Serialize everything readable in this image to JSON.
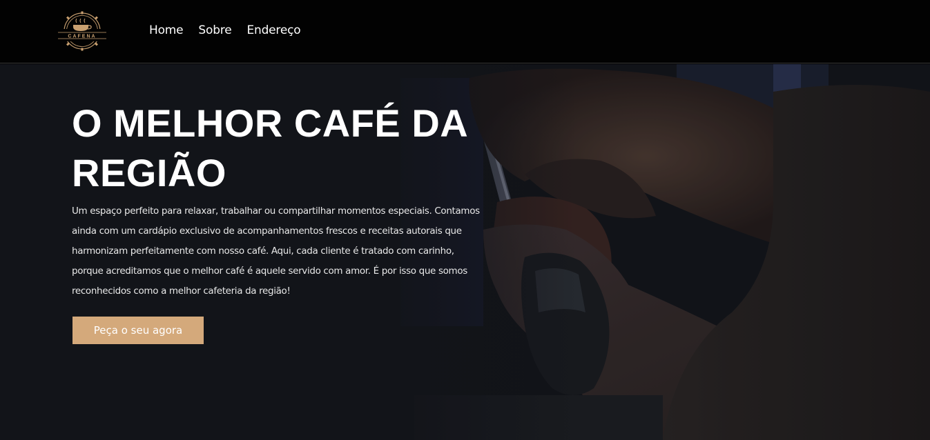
{
  "brand": {
    "logo_text": "CAFENA"
  },
  "nav": {
    "items": [
      {
        "label": "Home"
      },
      {
        "label": "Sobre"
      },
      {
        "label": "Endereço"
      }
    ]
  },
  "hero": {
    "title": "O MELHOR CAFÉ DA REGIÃO",
    "text": "Um espaço perfeito para relaxar, trabalhar ou compartilhar momentos especiais. Contamos ainda com um cardápio exclusivo de acompanhamentos frescos e receitas autorais que harmonizam perfeitamente com nosso café. Aqui, cada cliente é tratado com carinho, porque acreditamos que o melhor café é aquele servido com amor. É por isso que somos reconhecidos como a melhor cafeteria da região!",
    "cta_label": "Peça o seu agora"
  },
  "colors": {
    "accent": "#d4a97b",
    "header_bg": "#020202",
    "hero_bg": "#15171d",
    "logo_gold": "#c9a070"
  },
  "icons": {
    "logo": "coffee-cup-gear-logo"
  }
}
